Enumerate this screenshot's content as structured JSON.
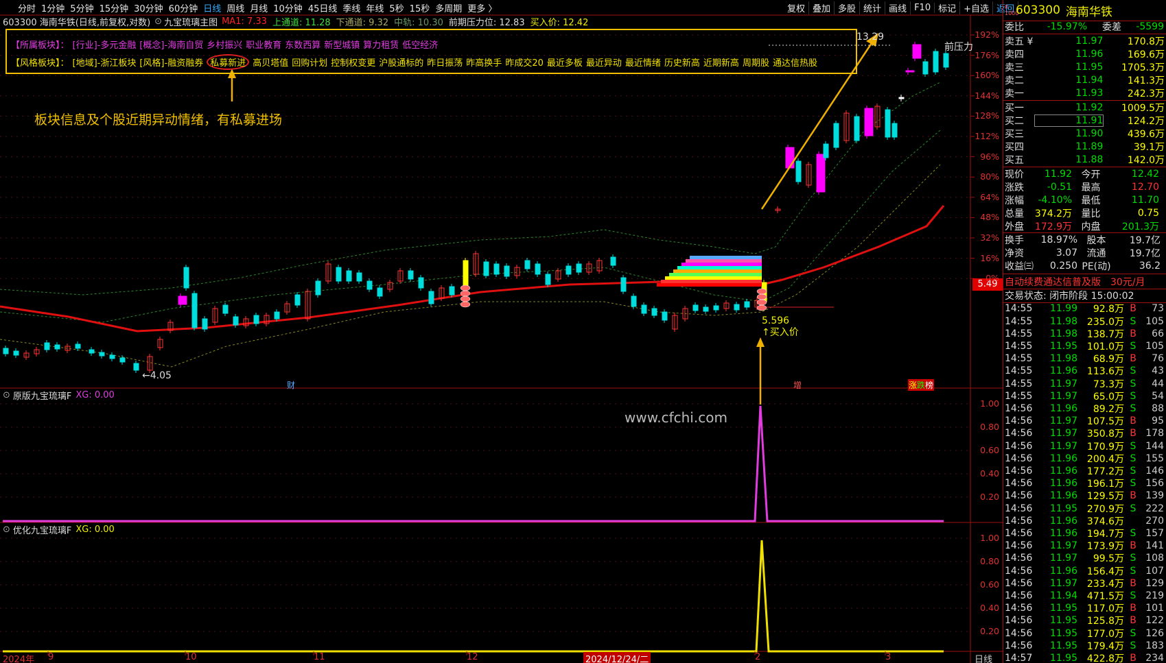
{
  "toolbar": {
    "periods": [
      "分时",
      "1分钟",
      "5分钟",
      "15分钟",
      "30分钟",
      "60分钟",
      "日线",
      "周线",
      "月线",
      "10分钟",
      "45日线",
      "季线",
      "年线",
      "5秒",
      "15秒",
      "多周期",
      "更多 〉"
    ],
    "active_period": "日线",
    "right_items": [
      "复权",
      "叠加",
      "多股",
      "统计",
      "画线",
      "F10",
      "标记",
      "+自选",
      "返回"
    ]
  },
  "header": {
    "stock_title": "603300 海南华铁(日线,前复权,对数)",
    "indicator_name": "九宝琉璃主图",
    "ma1_label": "MA1: 7.33",
    "upper_label": "上通道: 11.28",
    "lower_label": "下通道: 9.32",
    "mid_label": "中轨: 10.30",
    "pressure_label": "前期压力位: 12.83",
    "buy_label": "买入价: 12.42"
  },
  "info_box": {
    "line1_key": "【所属板块】：",
    "line1_items": [
      "[行业]-多元金融",
      "[概念]-海南自贸",
      "乡村振兴",
      "职业教育",
      "东数西算",
      "新型城镇",
      "算力租赁",
      "低空经济"
    ],
    "line2_key": "【风格板块】：",
    "line2_items": [
      "[地域]-浙江板块",
      "[风格]-融资融券",
      "私募新进",
      "高贝塔值",
      "回购计划",
      "控制权变更",
      "沪股通标的",
      "昨日振荡",
      "昨高换手",
      "昨成交20",
      "最近多板",
      "最近异动",
      "最近情绪",
      "历史新高",
      "近期新高",
      "周期股",
      "通达信热股"
    ]
  },
  "annotation": "板块信息及个股近期异动情绪，有私募进场",
  "main_chart": {
    "y_labels": [
      "192%",
      "176%",
      "160%",
      "144%",
      "128%",
      "112%",
      "96%",
      "80%",
      "64%",
      "48%",
      "32%",
      "16%",
      "0%"
    ],
    "current_price_tag": "5.49",
    "low_label": "←4.05",
    "high_label": "13.29",
    "buy_point_label": "5.596",
    "buy_point_text": "↑买入价",
    "front_pressure": "前压力",
    "markers": [
      "财",
      "增",
      "涨",
      "跌",
      "榜"
    ]
  },
  "panel1": {
    "title": "原版九宝琉璃F",
    "xg": "XG: 0.00",
    "y_labels": [
      "1.00",
      "0.80",
      "0.60",
      "0.40",
      "0.20"
    ],
    "watermark": "www.cfchi.com"
  },
  "panel2": {
    "title": "优化九宝琉璃F",
    "xg": "XG: 0.00",
    "y_labels": [
      "1.00",
      "0.80",
      "0.60",
      "0.40",
      "0.20"
    ]
  },
  "x_axis": {
    "labels": [
      "2024年",
      "9",
      "10",
      "11",
      "12",
      "2024/12/24/二",
      "2",
      "3"
    ],
    "period_label": "日线"
  },
  "right_panel": {
    "code": "603300",
    "name": "海南华铁",
    "weibi_label": "委比",
    "weibi": "-15.97%",
    "weicha_label": "委差",
    "weicha": "-5599",
    "asks": [
      {
        "label": "卖五 ¥",
        "price": "11.97",
        "vol": "170.8万"
      },
      {
        "label": "卖四",
        "price": "11.96",
        "vol": "169.6万"
      },
      {
        "label": "卖三",
        "price": "11.95",
        "vol": "1705.3万"
      },
      {
        "label": "卖二",
        "price": "11.94",
        "vol": "141.3万"
      },
      {
        "label": "卖一",
        "price": "11.93",
        "vol": "242.3万"
      }
    ],
    "bids": [
      {
        "label": "买一",
        "price": "11.92",
        "vol": "1009.5万"
      },
      {
        "label": "买二",
        "price": "11.91",
        "vol": "124.2万"
      },
      {
        "label": "买三",
        "price": "11.90",
        "vol": "439.6万"
      },
      {
        "label": "买四",
        "price": "11.89",
        "vol": "39.1万"
      },
      {
        "label": "买五",
        "price": "11.88",
        "vol": "142.0万"
      }
    ],
    "quote": [
      {
        "k1": "现价",
        "v1": "11.92",
        "k2": "今开",
        "v2": "12.42",
        "c1": "#0d0",
        "c2": "#0d0"
      },
      {
        "k1": "涨跌",
        "v1": "-0.51",
        "k2": "最高",
        "v2": "12.70",
        "c1": "#0d0",
        "c2": "#f33"
      },
      {
        "k1": "涨幅",
        "v1": "-4.10%",
        "k2": "最低",
        "v2": "11.70",
        "c1": "#0d0",
        "c2": "#0d0"
      },
      {
        "k1": "总量",
        "v1": "374.2万",
        "k2": "量比",
        "v2": "0.75",
        "c1": "#ff0",
        "c2": "#ff0"
      },
      {
        "k1": "外盘",
        "v1": "172.9万",
        "k2": "内盘",
        "v2": "201.3万",
        "c1": "#f33",
        "c2": "#0d0"
      }
    ],
    "fund": [
      {
        "k1": "换手",
        "v1": "18.97%",
        "k2": "股本",
        "v2": "19.7亿"
      },
      {
        "k1": "净资",
        "v1": "3.07",
        "k2": "流通",
        "v2": "19.7亿"
      },
      {
        "k1": "收益㈢",
        "v1": "0.250",
        "k2": "PE(动)",
        "v2": "36.2"
      }
    ],
    "ad_text": "自动续费通达信普及版",
    "ad_price": "30元/月",
    "trade_state": "交易状态: 闭市阶段 15:00:02",
    "ticks": [
      [
        "14:55",
        "11.99",
        "92.8万",
        "B",
        "73"
      ],
      [
        "14:55",
        "11.98",
        "235.0万",
        "S",
        "105"
      ],
      [
        "14:55",
        "11.98",
        "138.7万",
        "B",
        "66"
      ],
      [
        "14:55",
        "11.95",
        "101.0万",
        "S",
        "105"
      ],
      [
        "14:55",
        "11.98",
        "68.9万",
        "B",
        "76"
      ],
      [
        "14:55",
        "11.96",
        "113.6万",
        "S",
        "43"
      ],
      [
        "14:55",
        "11.97",
        "73.3万",
        "S",
        "44"
      ],
      [
        "14:55",
        "11.97",
        "65.0万",
        "S",
        "54"
      ],
      [
        "14:56",
        "11.96",
        "89.2万",
        "S",
        "88"
      ],
      [
        "14:56",
        "11.97",
        "107.5万",
        "B",
        "95"
      ],
      [
        "14:56",
        "11.97",
        "350.8万",
        "B",
        "178"
      ],
      [
        "14:56",
        "11.97",
        "170.9万",
        "S",
        "144"
      ],
      [
        "14:56",
        "11.96",
        "200.4万",
        "S",
        "155"
      ],
      [
        "14:56",
        "11.96",
        "177.2万",
        "S",
        "146"
      ],
      [
        "14:56",
        "11.96",
        "196.1万",
        "S",
        "156"
      ],
      [
        "14:56",
        "11.96",
        "129.5万",
        "B",
        "139"
      ],
      [
        "14:56",
        "11.95",
        "270.9万",
        "S",
        "222"
      ],
      [
        "14:56",
        "11.96",
        "374.6万",
        "",
        "270"
      ],
      [
        "14:56",
        "11.96",
        "194.7万",
        "S",
        "157"
      ],
      [
        "14:56",
        "11.97",
        "173.9万",
        "B",
        "141"
      ],
      [
        "14:56",
        "11.97",
        "99.5万",
        "S",
        "108"
      ],
      [
        "14:56",
        "11.96",
        "156.4万",
        "S",
        "107"
      ],
      [
        "14:56",
        "11.97",
        "233.4万",
        "B",
        "129"
      ],
      [
        "14:56",
        "11.94",
        "471.5万",
        "S",
        "219"
      ],
      [
        "14:56",
        "11.95",
        "117.0万",
        "B",
        "101"
      ],
      [
        "14:56",
        "11.95",
        "125.8万",
        "B",
        "122"
      ],
      [
        "14:56",
        "11.95",
        "177.0万",
        "S",
        "126"
      ],
      [
        "14:56",
        "11.95",
        "179.4万",
        "S",
        "183"
      ],
      [
        "14:57",
        "11.95",
        "422.8万",
        "B",
        "234"
      ]
    ]
  }
}
